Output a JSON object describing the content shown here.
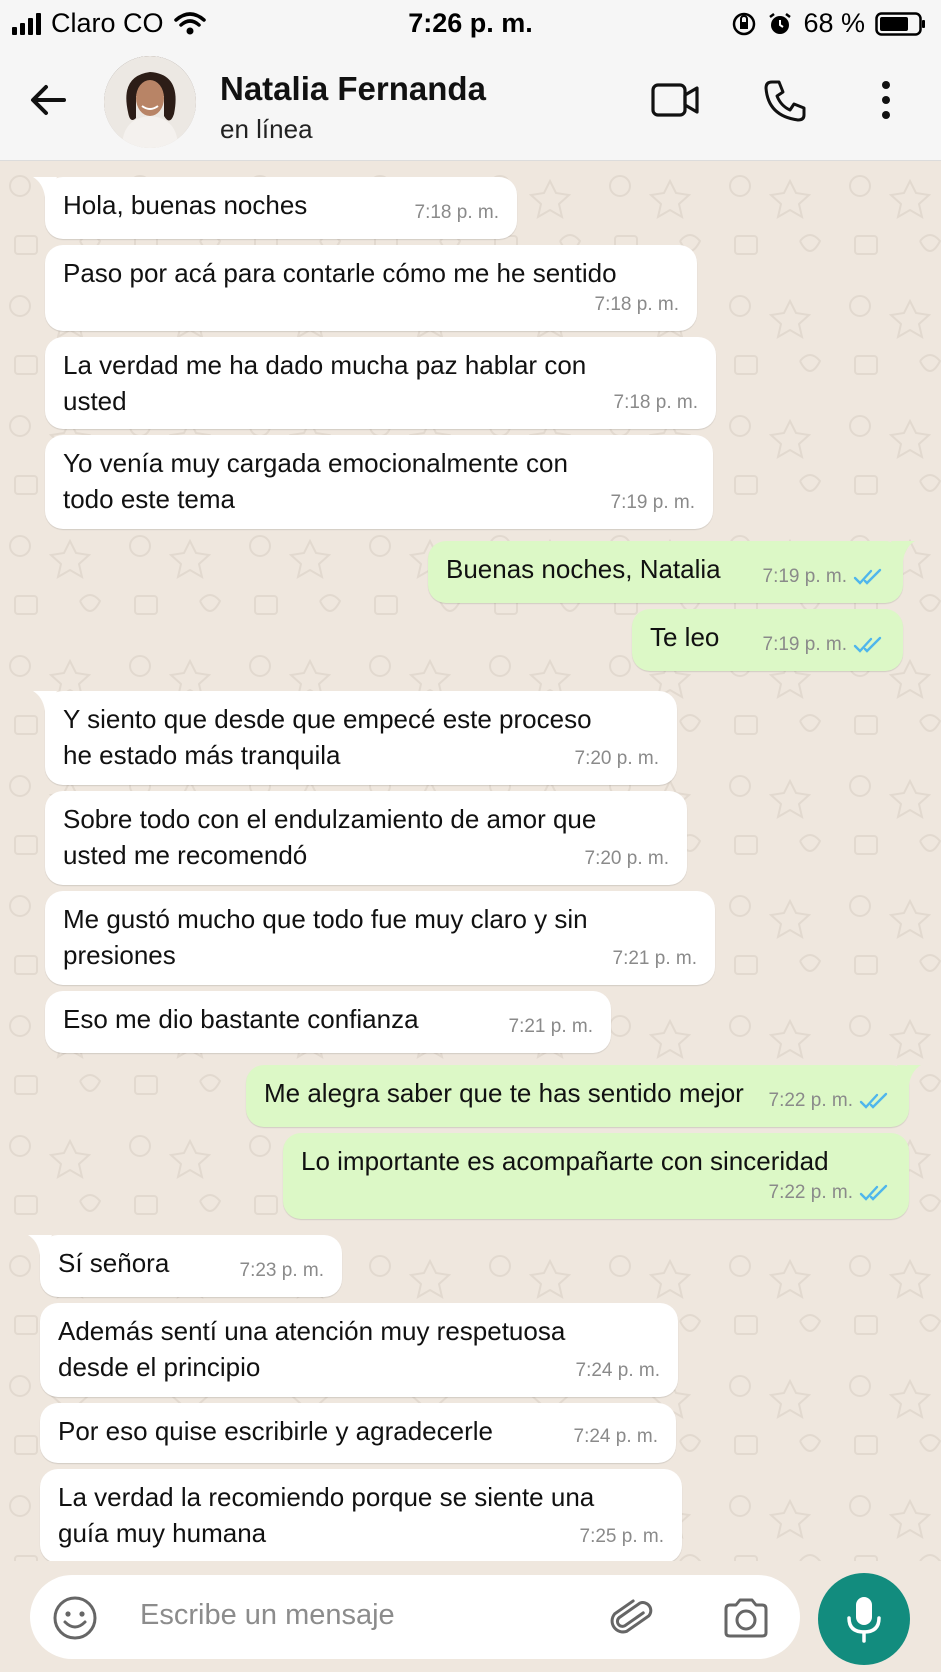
{
  "status_bar": {
    "carrier": "Claro CO",
    "time": "7:26 p. m.",
    "battery": "68 %"
  },
  "header": {
    "contact_name": "Natalia Fernanda",
    "contact_status": "en línea"
  },
  "messages": [
    {
      "dir": "in",
      "text": "Hola, buenas noches",
      "time": "7:18 p. m."
    },
    {
      "dir": "in",
      "text": "Paso por acá para contarle cómo me he sentido",
      "time": "7:18 p. m."
    },
    {
      "dir": "in",
      "text": "La verdad me ha dado mucha paz hablar con\nusted",
      "time": "7:18 p. m."
    },
    {
      "dir": "in",
      "text": "Yo venía muy cargada emocionalmente con\ntodo este tema",
      "time": "7:19 p. m."
    },
    {
      "dir": "out",
      "text": "Buenas noches, Natalia",
      "time": "7:19 p. m."
    },
    {
      "dir": "out",
      "text": "Te leo",
      "time": "7:19 p. m."
    },
    {
      "dir": "in",
      "text": "Y siento que desde que empecé este proceso\nhe estado más tranquila",
      "time": "7:20 p. m."
    },
    {
      "dir": "in",
      "text": "Sobre todo con el endulzamiento de amor que\nusted me recomendó",
      "time": "7:20 p. m."
    },
    {
      "dir": "in",
      "text": "Me gustó mucho que todo fue muy claro y sin\npresiones",
      "time": "7:21 p. m."
    },
    {
      "dir": "in",
      "text": "Eso me dio bastante confianza",
      "time": "7:21 p. m."
    },
    {
      "dir": "out",
      "text": "Me alegra saber que te has sentido mejor",
      "time": "7:22 p. m."
    },
    {
      "dir": "out",
      "text": "Lo importante es acompañarte con sinceridad",
      "time": "7:22 p. m."
    },
    {
      "dir": "in",
      "text": "Sí señora",
      "time": "7:23 p. m."
    },
    {
      "dir": "in",
      "text": "Además sentí una atención muy respetuosa\ndesde el principio",
      "time": "7:24 p. m."
    },
    {
      "dir": "in",
      "text": "Por eso quise escribirle y agradecerle",
      "time": "7:24 p. m."
    },
    {
      "dir": "in",
      "text": "La verdad la recomiendo porque se siente una\nguía muy humana",
      "time": "7:25 p. m."
    }
  ],
  "composer": {
    "placeholder": "Escribe un mensaje"
  },
  "colors": {
    "chat_bg": "#efe7de",
    "incoming": "#ffffff",
    "outgoing": "#dcf8c6",
    "read_ticks": "#4fb6ec",
    "mic_button": "#128c7e"
  }
}
